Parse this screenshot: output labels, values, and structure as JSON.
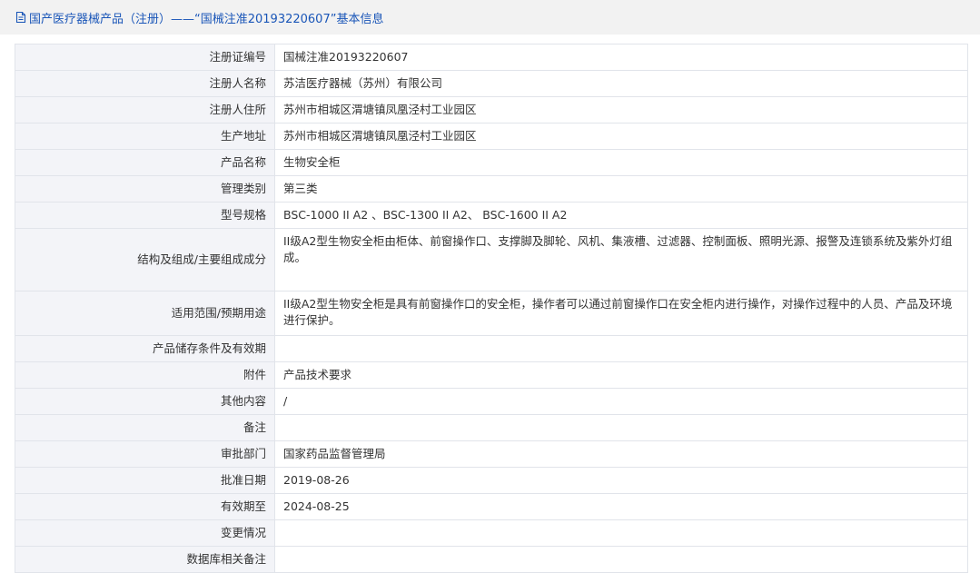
{
  "header": {
    "title": "国产医疗器械产品（注册）——“国械注准20193220607”基本信息",
    "icon": "document-icon",
    "title_color": "#1a56b8"
  },
  "rows": [
    {
      "label": "注册证编号",
      "value": "国械注准20193220607"
    },
    {
      "label": "注册人名称",
      "value": "苏洁医疗器械（苏州）有限公司"
    },
    {
      "label": "注册人住所",
      "value": "苏州市相城区渭塘镇凤凰泾村工业园区"
    },
    {
      "label": "生产地址",
      "value": "苏州市相城区渭塘镇凤凰泾村工业园区"
    },
    {
      "label": "产品名称",
      "value": "生物安全柜"
    },
    {
      "label": "管理类别",
      "value": "第三类"
    },
    {
      "label": "型号规格",
      "value": "BSC-1000 II A2 、BSC-1300 II A2、 BSC-1600 II A2"
    },
    {
      "label": "结构及组成/主要组成成分",
      "value": "II级A2型生物安全柜由柜体、前窗操作口、支撑脚及脚轮、风机、集液槽、过滤器、控制面板、照明光源、报警及连锁系统及紫外灯组成。"
    },
    {
      "label": "适用范围/预期用途",
      "value": "II级A2型生物安全柜是具有前窗操作口的安全柜，操作者可以通过前窗操作口在安全柜内进行操作，对操作过程中的人员、产品及环境进行保护。"
    },
    {
      "label": "产品储存条件及有效期",
      "value": ""
    },
    {
      "label": "附件",
      "value": "产品技术要求"
    },
    {
      "label": "其他内容",
      "value": "/"
    },
    {
      "label": "备注",
      "value": ""
    },
    {
      "label": "审批部门",
      "value": "国家药品监督管理局"
    },
    {
      "label": "批准日期",
      "value": "2019-08-26"
    },
    {
      "label": "有效期至",
      "value": "2024-08-25"
    },
    {
      "label": "变更情况",
      "value": ""
    },
    {
      "label": "数据库相关备注",
      "value": ""
    }
  ],
  "colors": {
    "label_bg": "#f3f4f8",
    "border": "#e1e4ea",
    "header_bg": "#f2f2f2"
  }
}
